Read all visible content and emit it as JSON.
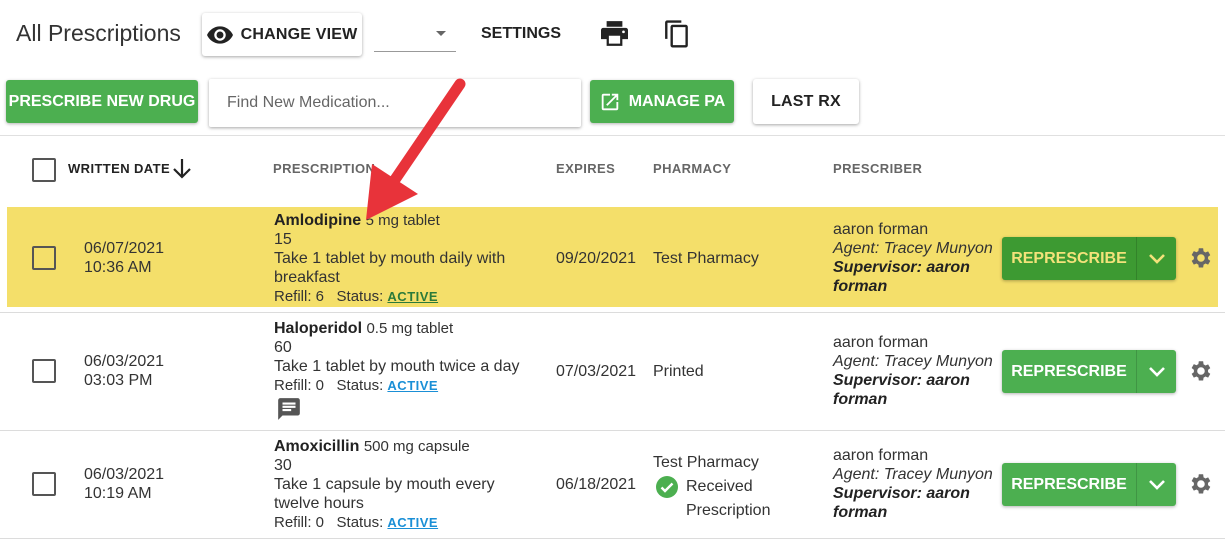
{
  "header": {
    "title": "All Prescriptions",
    "change_view_label": "CHANGE VIEW",
    "select_value": "",
    "settings_label": "SETTINGS"
  },
  "actions": {
    "prescribe_new_label": "PRESCRIBE NEW DRUG",
    "search_placeholder": "Find New Medication...",
    "manage_pa_label": "MANAGE PA",
    "last_rx_label": "LAST RX"
  },
  "table": {
    "columns": {
      "written_date": "WRITTEN DATE",
      "prescription": "PRESCRIPTION",
      "expires": "EXPIRES",
      "pharmacy": "PHARMACY",
      "prescriber": "PRESCRIBER"
    },
    "rows": [
      {
        "date": "06/07/2021",
        "time": "10:36 AM",
        "drug": "Amlodipine",
        "strength": "5 mg tablet",
        "quantity": "15",
        "sig": "Take 1 tablet by mouth daily with breakfast",
        "refill_label": "Refill: 6",
        "status_label": "Status:",
        "status": "ACTIVE",
        "expires": "09/20/2021",
        "pharmacy": "Test Pharmacy",
        "prescriber": "aaron forman",
        "agent": "Agent: Tracey Munyon",
        "supervisor": "Supervisor: aaron forman",
        "action_label": "REPRESCRIBE"
      },
      {
        "date": "06/03/2021",
        "time": "03:03 PM",
        "drug": "Haloperidol",
        "strength": "0.5 mg tablet",
        "quantity": "60",
        "sig": "Take 1 tablet by mouth twice a day",
        "refill_label": "Refill: 0",
        "status_label": "Status:",
        "status": "ACTIVE",
        "expires": "07/03/2021",
        "pharmacy": "Printed",
        "prescriber": "aaron forman",
        "agent": "Agent: Tracey Munyon",
        "supervisor": "Supervisor: aaron forman",
        "action_label": "REPRESCRIBE"
      },
      {
        "date": "06/03/2021",
        "time": "10:19 AM",
        "drug": "Amoxicillin",
        "strength": "500 mg capsule",
        "quantity": "30",
        "sig": "Take 1 capsule by mouth every twelve hours",
        "refill_label": "Refill: 0",
        "status_label": "Status:",
        "status": "ACTIVE",
        "expires": "06/18/2021",
        "pharmacy": "Test Pharmacy",
        "pharmacy_status": "Received Prescription",
        "prescriber": "aaron forman",
        "agent": "Agent: Tracey Munyon",
        "supervisor": "Supervisor: aaron forman",
        "action_label": "REPRESCRIBE"
      }
    ]
  },
  "colors": {
    "accent_green": "#4caf50",
    "highlight_yellow": "#f4df6a",
    "link_blue": "#1a8fd6",
    "arrow_red": "#e8333a"
  },
  "icons": [
    "eye-icon",
    "caret-down-icon",
    "print-icon",
    "copy-icon",
    "open-in-new-icon",
    "arrow-down-icon",
    "chat-icon",
    "check-circle-icon",
    "chevron-down-icon",
    "gear-icon"
  ]
}
